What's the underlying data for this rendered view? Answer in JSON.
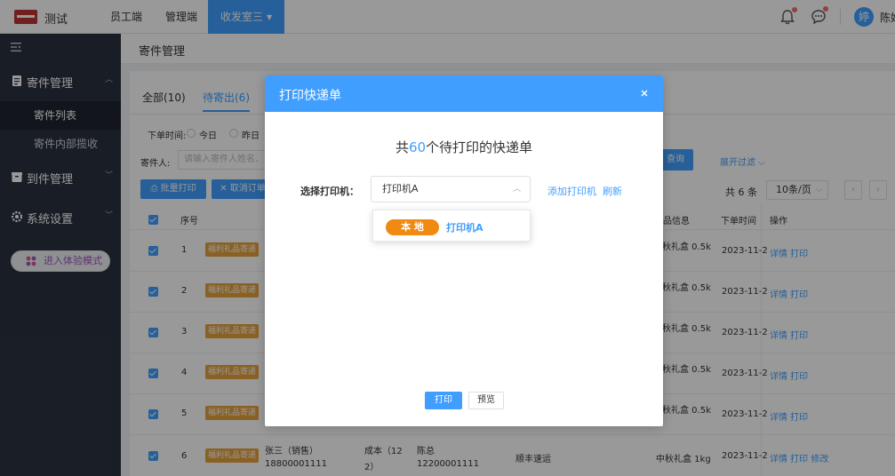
{
  "header": {
    "app_title": "测试",
    "nav": [
      "员工端",
      "管理端"
    ],
    "active_room": "收发室三",
    "avatar_char": "婷",
    "user_name": "陈妃"
  },
  "sidebar": {
    "groups": [
      {
        "label": "寄件管理",
        "icon": "document-icon"
      },
      {
        "label": "到件管理",
        "icon": "box-icon"
      },
      {
        "label": "系统设置",
        "icon": "gear-icon"
      }
    ],
    "sub_items": [
      "寄件列表",
      "寄件内部揽收"
    ],
    "trial_button": "进入体验模式"
  },
  "breadcrumb": "寄件管理",
  "tabs": [
    "全部(10)",
    "待寄出(6)"
  ],
  "filters": {
    "order_time_label": "下单时间:",
    "radio_today": "今日",
    "radio_yesterday": "昨日",
    "sender_label": "寄件人:",
    "sender_placeholder": "请输入寄件人姓名、电",
    "query_button": "查询",
    "expand_filter": "展开过滤 ⌵"
  },
  "actions": {
    "batch_print": "批量打印",
    "cancel_order": "取消订单"
  },
  "pagination": {
    "total": "共 6 条",
    "page_size": "10条/页"
  },
  "table": {
    "columns": [
      "序号",
      "品信息",
      "下单时间",
      "操作"
    ],
    "rows": [
      {
        "index": "1",
        "tag": "福利礼品寄递",
        "item": "秋礼盒 0.5k",
        "time": "2023-11-2",
        "ops": "详情 打印"
      },
      {
        "index": "2",
        "tag": "福利礼品寄递",
        "item": "秋礼盒 0.5k",
        "time": "2023-11-2",
        "ops": "详情 打印"
      },
      {
        "index": "3",
        "tag": "福利礼品寄递",
        "item": "秋礼盒 0.5k",
        "time": "2023-11-2",
        "ops": "详情 打印"
      },
      {
        "index": "4",
        "tag": "福利礼品寄递",
        "item": "秋礼盒 0.5k",
        "time": "2023-11-2",
        "ops": "详情 打印"
      },
      {
        "index": "5",
        "tag": "福利礼品寄递",
        "item": "秋礼盒 0.5k",
        "time": "2023-11-2",
        "ops": "详情 打印"
      }
    ],
    "last_row": {
      "index": "6",
      "tag": "福利礼品寄递",
      "sender": "张三（销售）",
      "sender_phone": "18800001111",
      "cost_line1": "成本（12",
      "cost_line2": "2）",
      "receiver": "陈总",
      "receiver_phone": "12200001111",
      "courier": "顺丰速运",
      "item": "中秋礼盒 1kg",
      "time": "2023-11-2",
      "ops": "详情 打印 修改"
    }
  },
  "modal": {
    "title": "打印快递单",
    "heading_prefix": "共",
    "heading_count": "60",
    "heading_suffix": "个待打印的快递单",
    "printer_label": "选择打印机：",
    "printer_value": "打印机A",
    "dropdown_tag": "本 地",
    "dropdown_name": "打印机A",
    "add_printer": "添加打印机",
    "refresh": "刷新",
    "print_button": "打印",
    "preview_button": "预览"
  },
  "colors": {
    "primary": "#409eff",
    "sidebar": "#2b3340",
    "tag": "#e6a23c",
    "dropdown_tag": "#f08a12"
  }
}
